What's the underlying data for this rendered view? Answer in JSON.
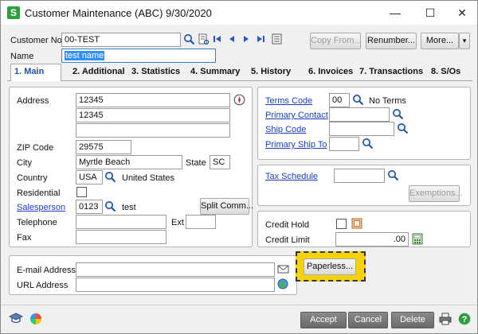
{
  "window": {
    "app_icon_letter": "S",
    "title": "Customer Maintenance (ABC) 9/30/2020",
    "controls": {
      "minimize": "—",
      "maximize": "☐",
      "close": "✕"
    }
  },
  "header": {
    "customer_no_label": "Customer No.",
    "customer_no_value": "00-TEST",
    "name_label": "Name",
    "name_value": "test name",
    "copy_from_label": "Copy From...",
    "renumber_label": "Renumber...",
    "more_label": "More...",
    "more_dropdown_glyph": "▾"
  },
  "tabs": [
    {
      "label": "1. Main",
      "active": true
    },
    {
      "label": "2. Additional"
    },
    {
      "label": "3. Statistics"
    },
    {
      "label": "4. Summary"
    },
    {
      "label": "5. History"
    },
    {
      "label": "6. Invoices"
    },
    {
      "label": "7. Transactions"
    },
    {
      "label": "8. S/Os"
    }
  ],
  "address_panel": {
    "address_label": "Address",
    "address_line1": "12345",
    "address_line2": "12345",
    "address_line3": "",
    "zip_label": "ZIP Code",
    "zip_value": "29575",
    "city_label": "City",
    "city_value": "Myrtle Beach",
    "state_label": "State",
    "state_value": "SC",
    "country_label": "Country",
    "country_code": "USA",
    "country_name": "United States",
    "residential_label": "Residential",
    "salesperson_label": "Salesperson",
    "salesperson_code": "0123",
    "salesperson_name": "test",
    "split_comm_label": "Split Comm...",
    "telephone_label": "Telephone",
    "telephone_value": "",
    "ext_label": "Ext",
    "ext_value": "",
    "fax_label": "Fax",
    "fax_value": ""
  },
  "terms_panel": {
    "terms_code_label": "Terms Code",
    "terms_code_value": "00",
    "terms_desc": "No Terms",
    "primary_contact_label": "Primary Contact",
    "ship_code_label": "Ship Code",
    "primary_ship_to_label": "Primary Ship To"
  },
  "tax_panel": {
    "tax_schedule_label": "Tax Schedule",
    "exemptions_label": "Exemptions..."
  },
  "credit_panel": {
    "credit_hold_label": "Credit Hold",
    "credit_limit_label": "Credit Limit",
    "credit_limit_value": ".00"
  },
  "contact_panel": {
    "email_label": "E-mail Address",
    "email_value": "",
    "url_label": "URL Address",
    "url_value": ""
  },
  "paperless_label": "Paperless...",
  "footer": {
    "accept_label": "Accept",
    "cancel_label": "Cancel",
    "delete_label": "Delete"
  },
  "colors": {
    "app_green": "#2e9e3e",
    "link_blue": "#1a3fbf",
    "highlight_yellow": "#f5d20b"
  }
}
